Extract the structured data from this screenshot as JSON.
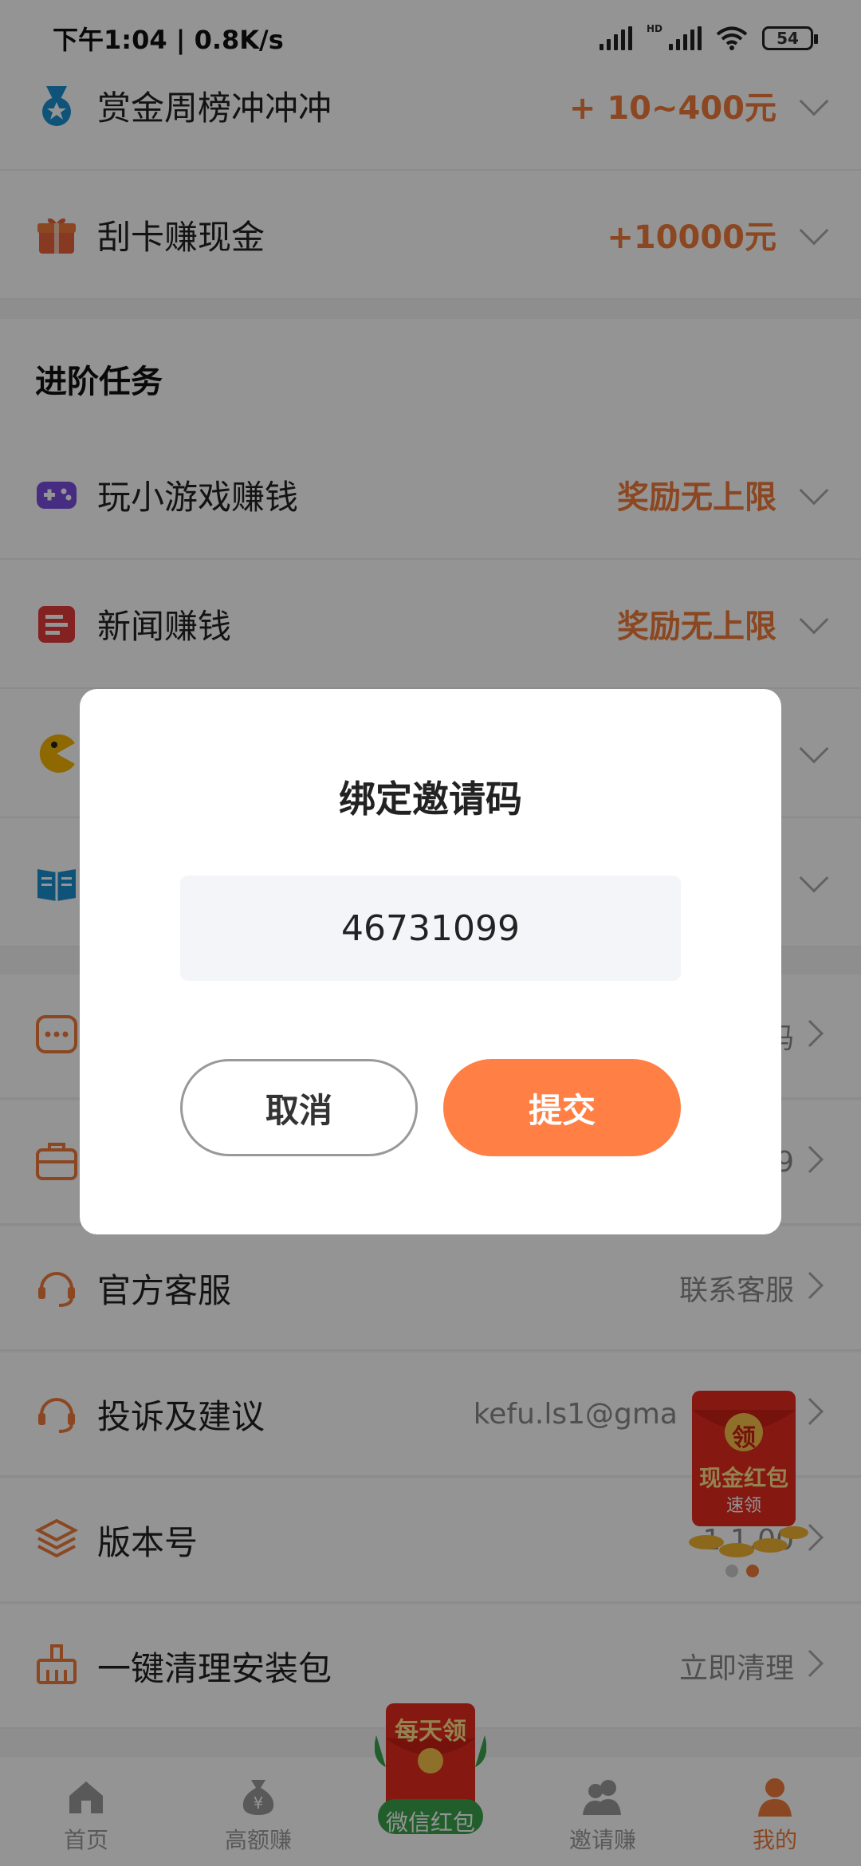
{
  "status_bar": {
    "time": "下午1:04 | 0.8K/s",
    "hd_label": "HD",
    "battery": "54"
  },
  "rows_top": [
    {
      "label": "赏金周榜冲冲冲",
      "reward": "+ 10~400元",
      "icon": "medal-icon"
    },
    {
      "label": "刮卡赚现金",
      "reward": "+10000元",
      "icon": "gift-box-icon"
    }
  ],
  "advanced": {
    "title": "进阶任务",
    "items": [
      {
        "label": "玩小游戏赚钱",
        "reward": "奖励无上限",
        "icon": "gamepad-icon"
      },
      {
        "label": "新闻赚钱",
        "reward": "奖励无上限",
        "icon": "news-icon"
      }
    ]
  },
  "settings": [
    {
      "label": "官方客服",
      "value": "联系客服",
      "icon": "headset-icon"
    },
    {
      "label": "投诉及建议",
      "value": "kefu.ls1@gma",
      "icon": "headset-icon"
    },
    {
      "label": "版本号",
      "value": "1.1.00",
      "icon": "layers-icon"
    },
    {
      "label": "一键清理安装包",
      "value": "立即清理",
      "icon": "cleanup-icon"
    }
  ],
  "partial_values": {
    "row_dots_value": "码",
    "row_briefcase_value": "9"
  },
  "float_promo": {
    "badge": "领",
    "line1": "现金红包",
    "line2": "速领"
  },
  "bottom_nav": {
    "items": [
      {
        "label": "首页",
        "icon": "home-icon"
      },
      {
        "label": "高额赚",
        "icon": "money-bag-icon"
      },
      {
        "label": "邀请赚",
        "icon": "users-icon"
      },
      {
        "label": "我的",
        "icon": "person-icon"
      }
    ],
    "center_top": "每天领",
    "center_bottom": "微信红包"
  },
  "modal": {
    "title": "绑定邀请码",
    "invite_code": "46731099",
    "cancel_label": "取消",
    "submit_label": "提交"
  },
  "colors": {
    "accent": "#f07a3a",
    "submit_button": "#ff7f45",
    "overlay": "rgba(0,0,0,0.42)"
  }
}
